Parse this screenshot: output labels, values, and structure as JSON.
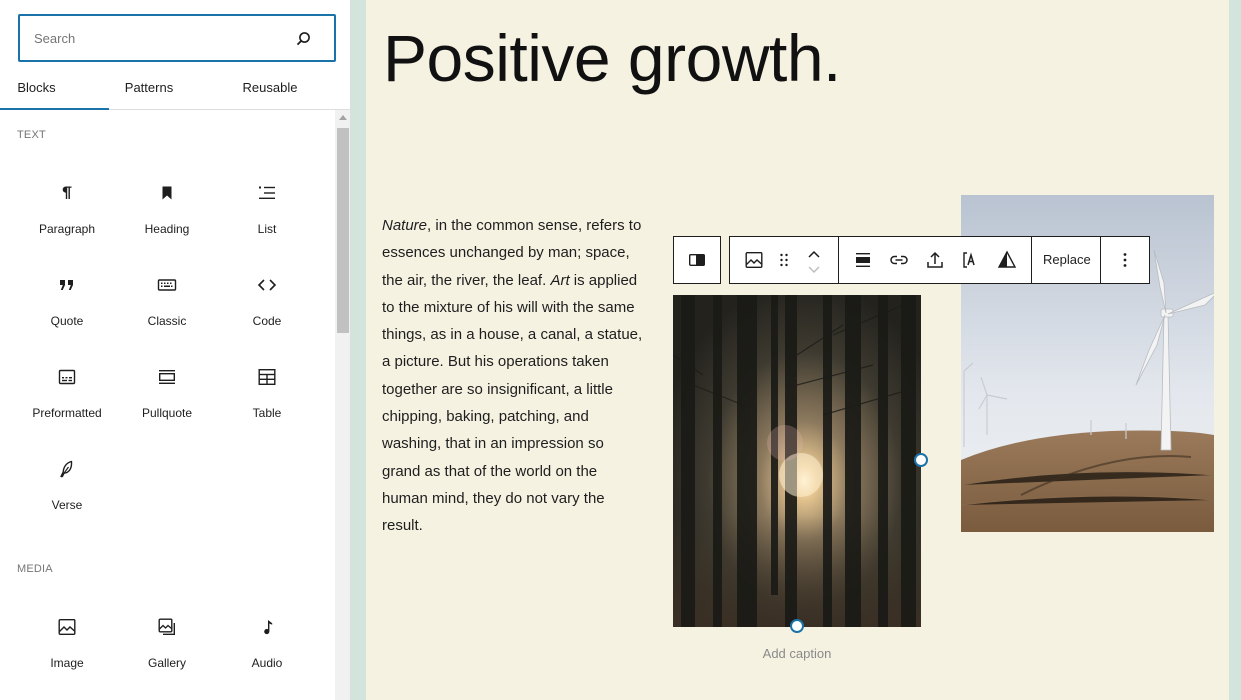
{
  "inserter": {
    "search": {
      "placeholder": "Search",
      "icon": "search-icon"
    },
    "tabs": [
      {
        "label": "Blocks",
        "active": true
      },
      {
        "label": "Patterns",
        "active": false
      },
      {
        "label": "Reusable",
        "active": false
      }
    ],
    "categories": [
      {
        "title": "TEXT",
        "blocks": [
          {
            "label": "Paragraph",
            "icon": "paragraph-icon"
          },
          {
            "label": "Heading",
            "icon": "heading-bookmark-icon"
          },
          {
            "label": "List",
            "icon": "list-icon"
          },
          {
            "label": "Quote",
            "icon": "quote-icon"
          },
          {
            "label": "Classic",
            "icon": "keyboard-icon"
          },
          {
            "label": "Code",
            "icon": "code-icon"
          },
          {
            "label": "Preformatted",
            "icon": "preformatted-icon"
          },
          {
            "label": "Pullquote",
            "icon": "pullquote-icon"
          },
          {
            "label": "Table",
            "icon": "table-icon"
          },
          {
            "label": "Verse",
            "icon": "feather-icon"
          }
        ]
      },
      {
        "title": "MEDIA",
        "blocks": [
          {
            "label": "Image",
            "icon": "image-icon"
          },
          {
            "label": "Gallery",
            "icon": "gallery-icon"
          },
          {
            "label": "Audio",
            "icon": "music-note-icon"
          }
        ]
      }
    ]
  },
  "canvas": {
    "title": "Positive growth.",
    "paragraph": {
      "em1": "Nature",
      "part1": ", in the common sense, refers to essences unchanged by man; space, the air, the river, the leaf. ",
      "em2": "Art",
      "part2": " is applied to the mixture of his will with the same things, as in a house, a canal, a statue, a picture. But his operations taken together are so insignificant, a little chipping, baking, patching, and washing, that in an impression so grand as that of the world on the human mind, they do not vary the result."
    },
    "caption_placeholder": "Add caption",
    "toolbar": {
      "replace_label": "Replace"
    }
  },
  "colors": {
    "accent": "#1a73a8",
    "canvas_bg": "#f5f2e2",
    "outer_bg": "#d3e4dd"
  }
}
